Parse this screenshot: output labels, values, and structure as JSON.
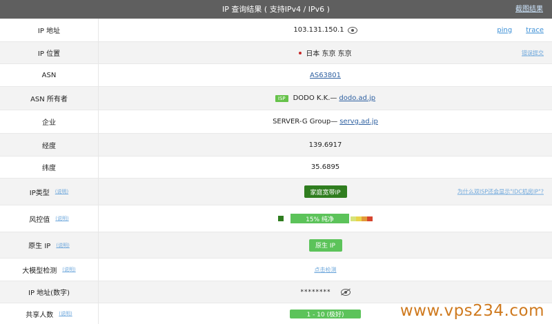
{
  "header": {
    "title": "IP 查询结果 ( 支持IPv4 / IPv6 )",
    "screenshot_label": "截图结果"
  },
  "rows": {
    "ip": {
      "label": "IP 地址",
      "value": "103.131.150.1",
      "ping": "ping",
      "trace": "trace"
    },
    "location": {
      "label": "IP 位置",
      "value": "日本 东京 东京",
      "report": "错误提交"
    },
    "asn": {
      "label": "ASN",
      "value": "AS63801"
    },
    "asn_owner": {
      "label": "ASN 所有者",
      "badge": "ISP",
      "name": "DODO K.K.—",
      "domain": "dodo.ad.jp"
    },
    "company": {
      "label": "企业",
      "name": "SERVER-G Group—",
      "domain": "servg.ad.jp"
    },
    "longitude": {
      "label": "经度",
      "value": "139.6917"
    },
    "latitude": {
      "label": "纬度",
      "value": "35.6895"
    },
    "ip_type": {
      "label": "IP类型",
      "hint": "(说明)",
      "value": "家庭宽带IP",
      "question": "为什么双ISP还会显示\"IDC机房IP\"?"
    },
    "risk": {
      "label": "风控值",
      "hint": "(说明)",
      "value": "15%  纯净",
      "percent": 15,
      "scale_colors": [
        "#d7e37a",
        "#e8d44a",
        "#e39a3a",
        "#d6452e"
      ]
    },
    "native": {
      "label": "原生 IP",
      "hint": "(说明)",
      "value": "原生 IP"
    },
    "ai_detect": {
      "label": "大模型检测",
      "hint": "(说明)",
      "value": "点击检测"
    },
    "ip_numeric": {
      "label": "IP 地址(数字)",
      "value": "********"
    },
    "shared_users": {
      "label": "共享人数",
      "hint": "(说明)",
      "value": "1 - 10 (极好)"
    }
  },
  "watermark": "www.vps234.com",
  "colors": {
    "header_bg": "#5f5f5f",
    "green_dark": "#2f7d1f",
    "green_light": "#5cc35a",
    "link": "#3b8fd6",
    "watermark": "#cf7a1f"
  }
}
